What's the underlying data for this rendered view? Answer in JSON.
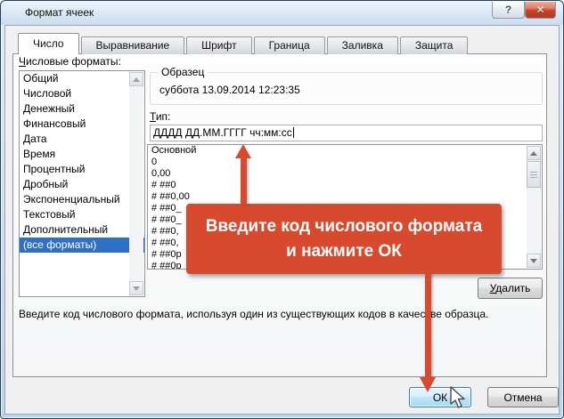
{
  "window": {
    "title": "Формат ячеек",
    "help_icon": "?",
    "close_icon": "✕"
  },
  "tabs": [
    {
      "label": "Число",
      "active": true
    },
    {
      "label": "Выравнивание",
      "active": false
    },
    {
      "label": "Шрифт",
      "active": false
    },
    {
      "label": "Граница",
      "active": false
    },
    {
      "label": "Заливка",
      "active": false
    },
    {
      "label": "Защита",
      "active": false
    }
  ],
  "number_formats": {
    "label": "Числовые форматы:",
    "items": [
      "Общий",
      "Числовой",
      "Денежный",
      "Финансовый",
      "Дата",
      "Время",
      "Процентный",
      "Дробный",
      "Экспоненциальный",
      "Текстовый",
      "Дополнительный",
      "(все форматы)"
    ],
    "selected_index": 11
  },
  "sample": {
    "label": "Образец",
    "value": "суббота 13.09.2014 12:23:35"
  },
  "type_field": {
    "label": "Тип:",
    "value": "ДДДД ДД.ММ.ГГГГ чч:мм:сс"
  },
  "format_codes": [
    "Основной",
    "0",
    "0,00",
    "# ##0",
    "# ##0,00",
    "# ##0_",
    "# ##0_",
    "# ##0,",
    "# ##0,",
    "# ##0р",
    "# ##0р"
  ],
  "delete_button": "Удалить",
  "description": "Введите код числового формата, используя один из существующих кодов в качестве образца.",
  "buttons": {
    "ok": "ОК",
    "cancel": "Отмена"
  },
  "callout": {
    "text": "Введите код числового формата\nи нажмите ОК"
  },
  "colors": {
    "accent": "#d84a2d",
    "selection": "#2f6fc5"
  }
}
